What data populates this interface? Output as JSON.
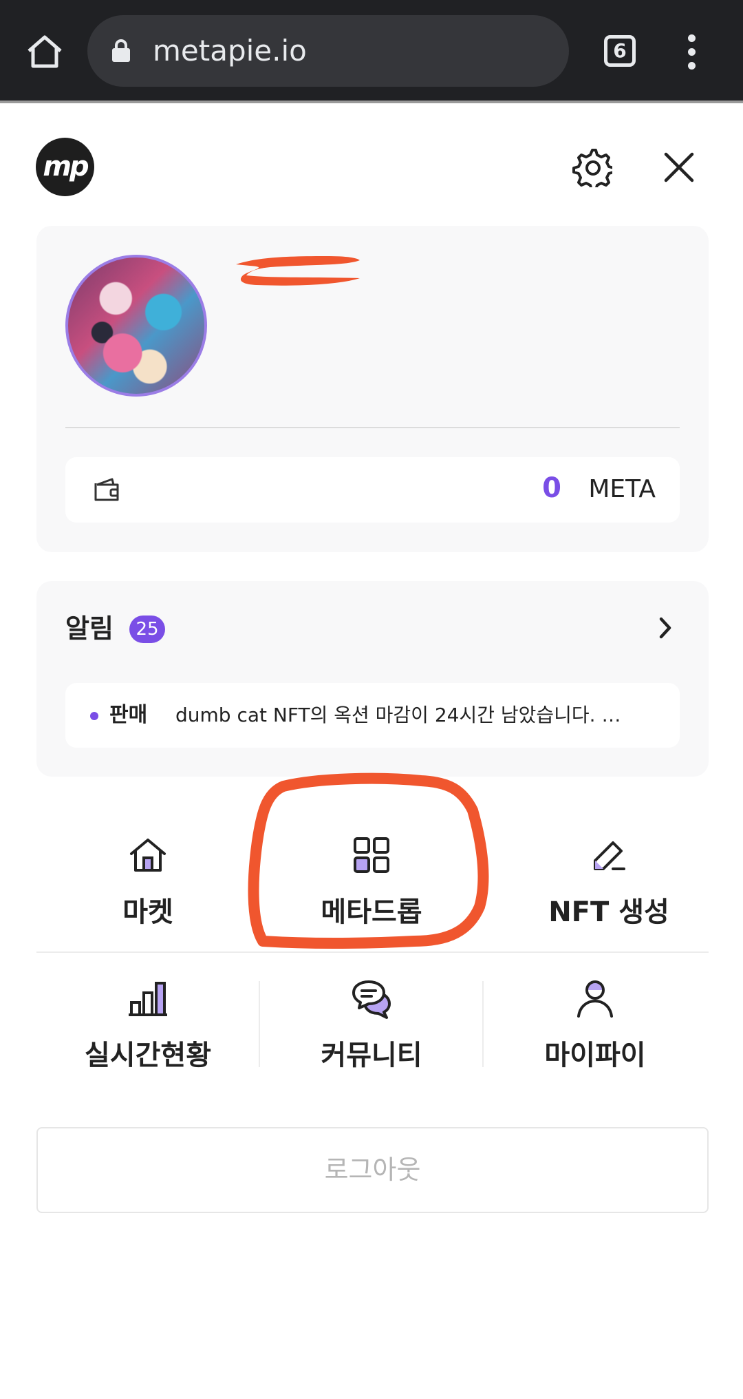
{
  "browser": {
    "url": "metapie.io",
    "tab_count": "6"
  },
  "header": {
    "logo_text": "mp"
  },
  "profile": {
    "balance": "0",
    "currency": "META"
  },
  "notifications": {
    "title": "알림",
    "count": "25",
    "items": [
      {
        "category": "판매",
        "message": "dumb cat NFT의 옥션 마감이 24시간 남았습니다. …"
      }
    ]
  },
  "menu": {
    "row1": [
      {
        "label": "마켓",
        "icon": "home-icon"
      },
      {
        "label": "메타드롭",
        "icon": "grid-icon"
      },
      {
        "label": "NFT 생성",
        "icon": "pencil-icon"
      }
    ],
    "row2": [
      {
        "label": "실시간현황",
        "icon": "bar-chart-icon"
      },
      {
        "label": "커뮤니티",
        "icon": "chat-icon"
      },
      {
        "label": "마이파이",
        "icon": "user-icon"
      }
    ]
  },
  "logout_label": "로그아웃",
  "colors": {
    "accent": "#7a4ee6",
    "annotation": "#f0562e",
    "chrome_bg": "#202124"
  }
}
